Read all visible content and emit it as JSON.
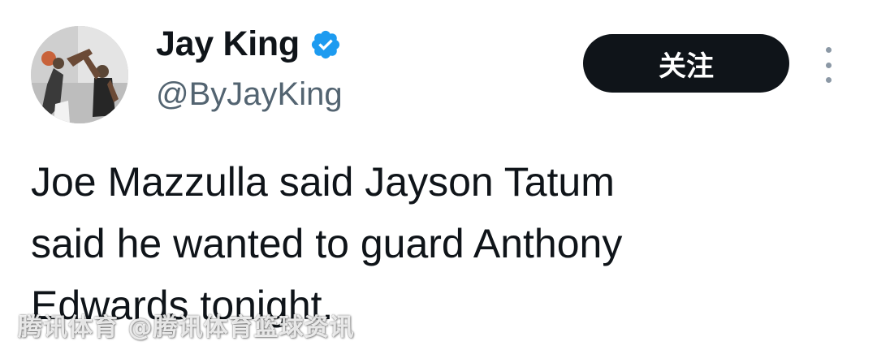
{
  "user": {
    "display_name": "Jay King",
    "handle": "@ByJayKing",
    "verified_icon": "verified-badge-icon",
    "verified_color": "#1d9bf0"
  },
  "actions": {
    "follow_label": "关注",
    "more_icon": "more-vertical-icon"
  },
  "tweet": {
    "text": "Joe Mazzulla said Jayson Tatum\nsaid he wanted to guard Anthony\nEdwards tonight."
  },
  "watermark": {
    "text": "腾讯体育 @腾讯体育篮球资讯"
  },
  "colors": {
    "text": "#0f1419",
    "secondary": "#536471",
    "button_bg": "#0f1419",
    "button_text": "#ffffff"
  }
}
